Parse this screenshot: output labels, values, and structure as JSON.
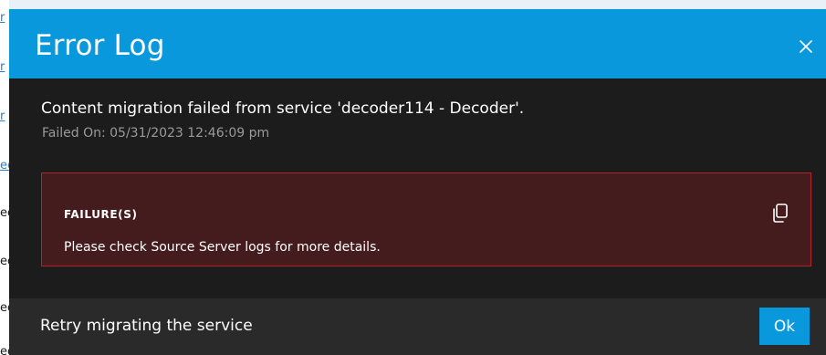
{
  "background": {
    "fragments": [
      {
        "text": "r",
        "style": "link"
      },
      {
        "text": "r",
        "style": "link"
      },
      {
        "text": "r",
        "style": "link"
      },
      {
        "text": "ec",
        "style": "link"
      },
      {
        "text": "ec",
        "style": "plain"
      },
      {
        "text": "ec",
        "style": "plain"
      },
      {
        "text": "ec",
        "style": "plain"
      },
      {
        "text": "ec",
        "style": "plain"
      }
    ]
  },
  "dialog": {
    "title": "Error Log",
    "close_icon": "close-icon",
    "message": "Content migration failed from service 'decoder114 - Decoder'.",
    "failed_on": "Failed On: 05/31/2023 12:46:09 pm",
    "failure": {
      "heading": "FAILURE(S)",
      "text": "Please check Source Server logs for more details.",
      "copy_icon": "copy-icon"
    },
    "footer": {
      "text": "Retry migrating the service",
      "ok_label": "Ok"
    }
  },
  "colors": {
    "header": "#0a98dd",
    "body": "#1c1c1c",
    "failure_bg": "#451c1e",
    "failure_border": "#b3242b",
    "footer": "#2a2a2a",
    "accent": "#0a98dd"
  }
}
